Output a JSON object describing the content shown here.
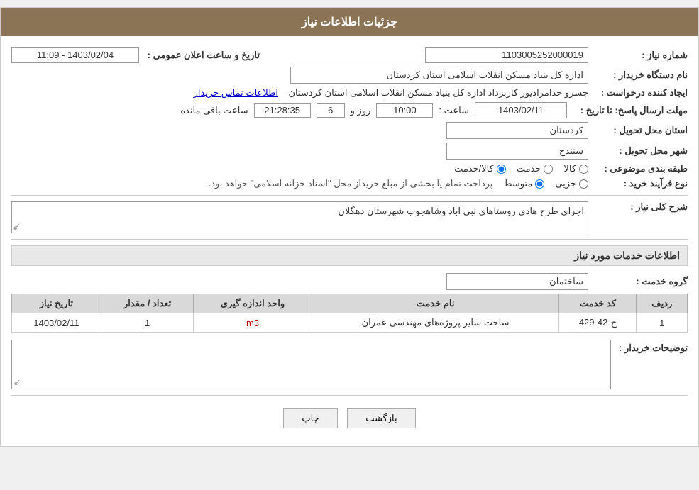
{
  "header": {
    "title": "جزئیات اطلاعات نیاز"
  },
  "fields": {
    "shomareNiaz_label": "شماره نیاز :",
    "shomareNiaz_value": "1103005252000019",
    "namDastgahKharidad_label": "نام دستگاه خریدار :",
    "namDastgahKharidad_value": "اداره کل بنیاد مسکن انقلاب اسلامی استان کردستان",
    "ijadKonandeLabel": "ایجاد کننده درخواست :",
    "ijadKonande_value": "جسرو خدامرادیور کاربرداد اداره کل بنیاد مسکن انقلاب اسلامی استان کردستان",
    "ijadKonandeLinkText": "اطلاعات تماس خریدار",
    "mohlatErsal_label": "مهلت ارسال پاسخ: تا تاریخ :",
    "mohlatDate": "1403/02/11",
    "mohlatSaat_label": "ساعت :",
    "mohlatSaat": "10:00",
    "mohlatRoz_label": "روز و",
    "mohlatRoz": "6",
    "mohlatClock": "21:28:35",
    "mohlatMande_label": "ساعت باقی مانده",
    "ostan_label": "استان محل تحویل :",
    "ostan_value": "کردستان",
    "shahr_label": "شهر محل تحویل :",
    "shahr_value": "سنندج",
    "tabaqeBandi_label": "طبقه بندی موضوعی :",
    "tabaqe_kala": "کالا",
    "tabaqe_khadamat": "خدمت",
    "tabaqe_kala_khadamat": "کالا/خدمت",
    "noeFarayand_label": "نوع فرآیند خرید :",
    "noeFarayand_jozi": "جزیی",
    "noeFarayand_motavasset": "متوسط",
    "noeFarayand_desc": "پرداخت تمام یا بخشی از مبلغ خریداز محل \"اسناد خزانه اسلامی\" خواهد بود.",
    "sharhKoli_label": "شرح کلی نیاز :",
    "sharhKoli_value": "اجرای طرح هادی روستاهای نبی آباد وشاهجوب شهرستان دهگلان",
    "section2_title": "اطلاعات خدمات مورد نیاز",
    "groheKhadamat_label": "گروه خدمت :",
    "groheKhadamat_value": "ساختمان",
    "table_headers": {
      "radif": "ردیف",
      "kodKhadamat": "کد خدمت",
      "namKhadamat": "نام خدمت",
      "vahedAndaze": "واحد اندازه گیری",
      "tedadMegdar": "تعداد / مقدار",
      "tarikheNiaz": "تاریخ نیاز"
    },
    "table_rows": [
      {
        "radif": "1",
        "kodKhadamat": "ج-42-429",
        "namKhadamat": "ساخت سایر پروژه‌های مهندسی عمران",
        "vahedAndaze": "m3",
        "tedadMegdar": "1",
        "tarikheNiaz": "1403/02/11"
      }
    ],
    "tozihat_label": "توضیحات خریدار :",
    "buttons": {
      "chap": "چاپ",
      "bazgasht": "بازگشت"
    }
  }
}
